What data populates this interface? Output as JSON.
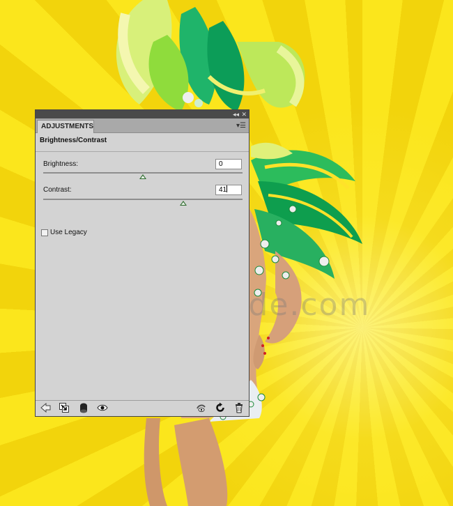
{
  "background": {
    "colors": {
      "sun_yellow": "#f7dc12",
      "ray_light": "#fbe61c",
      "ray_dark": "#f2d40c"
    },
    "watermark": "www.psd-dude.com"
  },
  "panel": {
    "title_bar_icons": [
      "collapse-icon",
      "close-icon"
    ],
    "tab": "ADJUSTMENTS",
    "title": "Brightness/Contrast",
    "brightness": {
      "label": "Brightness:",
      "value": "0",
      "slider_fraction": 0.5
    },
    "contrast": {
      "label": "Contrast:",
      "value": "41",
      "slider_fraction": 0.705
    },
    "use_legacy": {
      "label": "Use Legacy",
      "checked": false
    },
    "footer_icons": [
      "back-arrow-icon",
      "clip-to-layer-icon",
      "layer-mask-icon",
      "visibility-eye-icon",
      "view-previous-state-icon",
      "reset-icon",
      "delete-icon"
    ]
  }
}
